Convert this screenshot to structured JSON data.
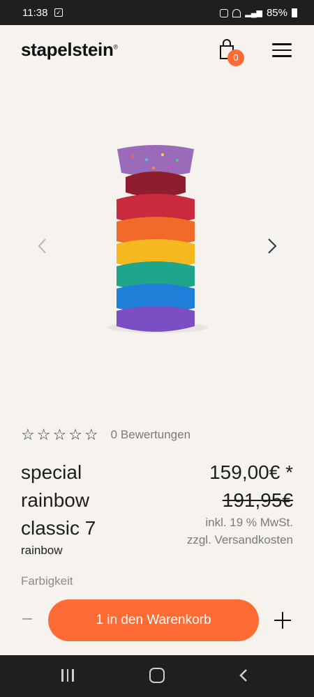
{
  "status_bar": {
    "time": "11:38",
    "battery": "85%"
  },
  "header": {
    "logo": "stapelstein",
    "logo_mark": "®",
    "cart_count": "0"
  },
  "icons": [
    "check-icon",
    "alarm-icon",
    "wifi-icon",
    "signal-icon",
    "battery-icon",
    "cart-icon",
    "menu-icon",
    "chevron-left-icon",
    "chevron-right-icon",
    "star-icon",
    "plus-icon",
    "minus-icon"
  ],
  "product": {
    "rating_stars": [
      "☆",
      "☆",
      "☆",
      "☆",
      "☆"
    ],
    "reviews_label": "0 Bewertungen",
    "title_lines": [
      "special",
      "rainbow",
      "classic 7"
    ],
    "variant": "rainbow",
    "price": "159,00€ *",
    "old_price": "191,95€",
    "tax_note": "inkl. 19 % MwSt.",
    "shipping_note": "zzgl. Versandkosten",
    "option_label": "Farbigkeit"
  },
  "cart_bar": {
    "add_label": "1 in den Warenkorb"
  },
  "colors": {
    "accent": "#ff6b35",
    "background": "#f6f3ee",
    "stones": [
      "#c92a3c",
      "#f06b2a",
      "#f5b81f",
      "#1ea58c",
      "#1f7fd8",
      "#7b4ec4"
    ]
  }
}
